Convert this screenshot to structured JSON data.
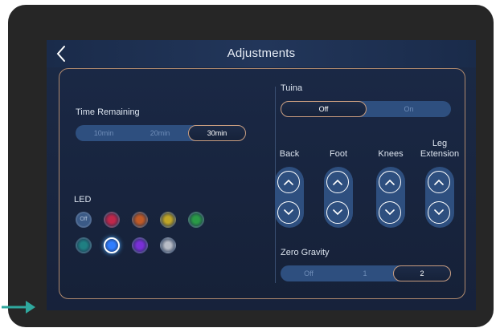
{
  "header": {
    "title": "Adjustments",
    "back_icon": "chevron-left-icon"
  },
  "time_remaining": {
    "label": "Time Remaining",
    "options": [
      "10min",
      "20min",
      "30min"
    ],
    "selected": "30min"
  },
  "led": {
    "label": "LED",
    "off_label": "Off",
    "colors": [
      "#c0264a",
      "#c05a26",
      "#c0a526",
      "#2a9a46",
      "#1f7f82",
      "#2f7dff",
      "#7a2fd8",
      "#b8bcc6"
    ],
    "selected_color": "#2f7dff"
  },
  "tuina": {
    "label": "Tuina",
    "options": [
      "Off",
      "On"
    ],
    "selected": "Off"
  },
  "adjusters": [
    {
      "label": "Back",
      "up_icon": "chevron-up-icon",
      "down_icon": "chevron-down-icon"
    },
    {
      "label": "Foot",
      "up_icon": "chevron-up-icon",
      "down_icon": "chevron-down-icon"
    },
    {
      "label": "Knees",
      "up_icon": "chevron-up-icon",
      "down_icon": "chevron-down-icon"
    },
    {
      "label": "Leg\nExtension",
      "up_icon": "chevron-up-icon",
      "down_icon": "chevron-down-icon"
    }
  ],
  "zero_gravity": {
    "label": "Zero Gravity",
    "options": [
      "Off",
      "1",
      "2"
    ],
    "selected": "2"
  },
  "colors": {
    "accent": "#c89c7f",
    "screen_bg": "#17223b",
    "control_bg": "#2e4f7f",
    "pointer_arrow": "#2fa89e"
  },
  "annotation": {
    "pointer_icon": "arrow-right-icon"
  }
}
